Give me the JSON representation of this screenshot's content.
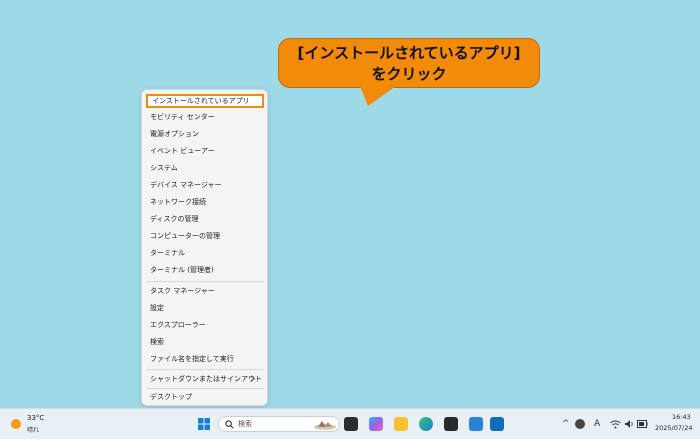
{
  "callout": {
    "line1": "[インストールされているアプリ]",
    "line2": "をクリック"
  },
  "menu": {
    "items": [
      {
        "label": "インストールされているアプリ"
      },
      {
        "label": "モビリティ センター"
      },
      {
        "label": "電源オプション"
      },
      {
        "label": "イベント ビューアー"
      },
      {
        "label": "システム"
      },
      {
        "label": "デバイス マネージャー"
      },
      {
        "label": "ネットワーク接続"
      },
      {
        "label": "ディスクの管理"
      },
      {
        "label": "コンピューターの管理"
      },
      {
        "label": "ターミナル"
      },
      {
        "label": "ターミナル (管理者)"
      },
      {
        "label": "タスク マネージャー"
      },
      {
        "label": "設定"
      },
      {
        "label": "エクスプローラー"
      },
      {
        "label": "検索"
      },
      {
        "label": "ファイル名を指定して実行"
      },
      {
        "label": "シャットダウンまたはサインアウト",
        "arrow": ">"
      },
      {
        "label": "デスクトップ"
      }
    ]
  },
  "taskbar": {
    "weather": {
      "temp": "33°C",
      "condition": "晴れ"
    },
    "search": {
      "placeholder": "検索"
    },
    "tray": {
      "chevron": "^",
      "ime": "A"
    },
    "clock": {
      "time": "16:43",
      "date": "2025/07/24"
    }
  },
  "colors": {
    "desktop": "#9ed9e8",
    "accent": "#f28a0a",
    "taskbar": "#e9f0f5"
  }
}
